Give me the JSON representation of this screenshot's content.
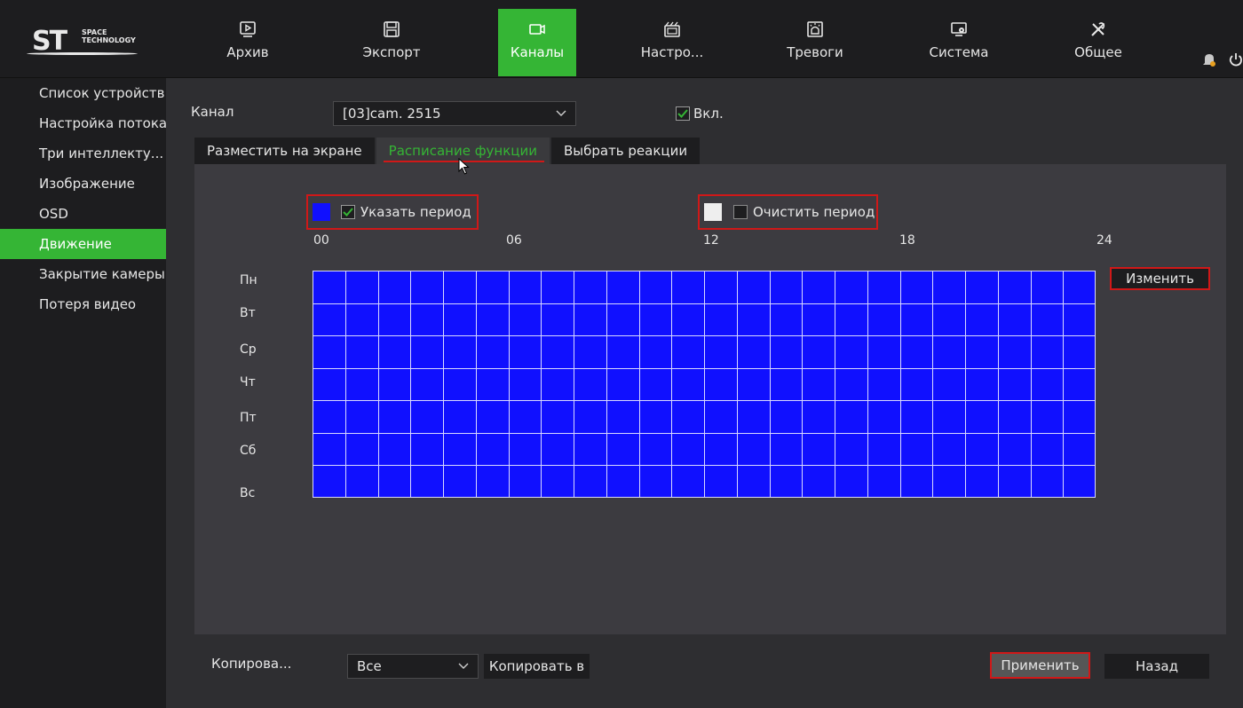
{
  "logo": {
    "mark": "ST",
    "sub_line1": "SPACE",
    "sub_line2": "TECHNOLOGY"
  },
  "nav": [
    {
      "label": "Архив",
      "icon": "playback-icon"
    },
    {
      "label": "Экспорт",
      "icon": "save-disk-icon"
    },
    {
      "label": "Каналы",
      "icon": "camera-icon"
    },
    {
      "label": "Настро...",
      "icon": "record-settings-icon"
    },
    {
      "label": "Тревоги",
      "icon": "alarm-icon"
    },
    {
      "label": "Система",
      "icon": "system-monitor-icon"
    },
    {
      "label": "Общее",
      "icon": "tools-icon"
    }
  ],
  "nav_active": "Каналы",
  "sidebar": {
    "items": [
      {
        "label": "Список устройств"
      },
      {
        "label": "Настройка потока"
      },
      {
        "label": "Три интеллекту..."
      },
      {
        "label": "Изображение"
      },
      {
        "label": "OSD"
      },
      {
        "label": "Движение"
      },
      {
        "label": "Закрытие камеры"
      },
      {
        "label": "Потеря видео"
      }
    ],
    "active": "Движение"
  },
  "channel": {
    "label": "Канал",
    "value": "[03]cam. 2515",
    "enable_label": "Вкл.",
    "enabled": true
  },
  "tabs": {
    "items": [
      {
        "label": "Разместить на экране"
      },
      {
        "label": "Расписание функции"
      },
      {
        "label": "Выбрать реакции"
      }
    ],
    "active": "Расписание функции"
  },
  "schedule": {
    "set_period_label": "Указать период",
    "set_period_checked": true,
    "set_color": "#1010ff",
    "clear_period_label": "Очистить период",
    "clear_period_checked": false,
    "clear_color": "#eeeeee",
    "hour_ticks": [
      "00",
      "06",
      "12",
      "18",
      "24"
    ],
    "days": [
      "Пн",
      "Вт",
      "Ср",
      "Чт",
      "Пт",
      "Сб",
      "Вс"
    ],
    "hours_per_day": 24,
    "all_selected": true,
    "edit_label": "Изменить"
  },
  "footer": {
    "copy_label": "Копирова...",
    "copy_select_value": "Все",
    "copy_to_label": "Копировать в",
    "apply_label": "Применить",
    "back_label": "Назад"
  },
  "colors": {
    "accent": "#35b535",
    "highlight_red": "#d01818",
    "schedule_blue": "#1010ff",
    "notification": "#e8a020"
  }
}
